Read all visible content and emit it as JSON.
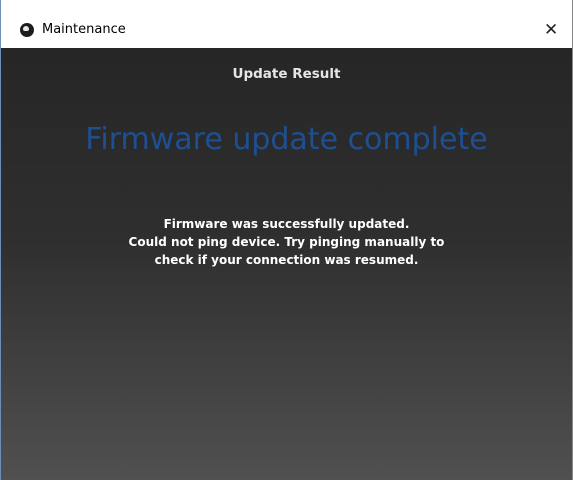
{
  "window": {
    "title": "Maintenance",
    "icon": "app-logo-icon",
    "close_glyph": "✕"
  },
  "content": {
    "section_title": "Update Result",
    "headline": "Firmware update complete",
    "message_lines": [
      "Firmware was successfully updated.",
      "Could not ping device. Try pinging manually to",
      "check if your connection was resumed."
    ]
  },
  "colors": {
    "headline": "#1e4f91",
    "background_top": "#262626",
    "background_bottom": "#505050",
    "text": "#ffffff"
  }
}
